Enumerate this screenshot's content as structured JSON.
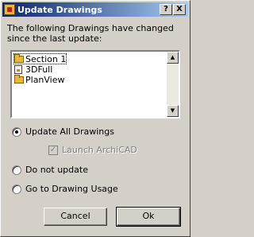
{
  "window": {
    "title": "Update Drawings",
    "help_label": "?",
    "close_label": "X"
  },
  "prompt": "The following Drawings have changed since the last update:",
  "list": {
    "items": [
      {
        "label": "Section 1",
        "icon": "folder-icon",
        "selected": true
      },
      {
        "label": "3DFull",
        "icon": "drawing-icon",
        "selected": false
      },
      {
        "label": "PlanView",
        "icon": "folder-icon",
        "selected": false
      }
    ],
    "scroll_up": "▲",
    "scroll_down": "▼"
  },
  "options": {
    "update_all": "Update All Drawings",
    "launch_label": "Launch ArchiCAD",
    "do_not_update": "Do not update",
    "go_to_usage": "Go to Drawing Usage",
    "selected": "update_all"
  },
  "buttons": {
    "cancel": "Cancel",
    "ok": "Ok"
  }
}
